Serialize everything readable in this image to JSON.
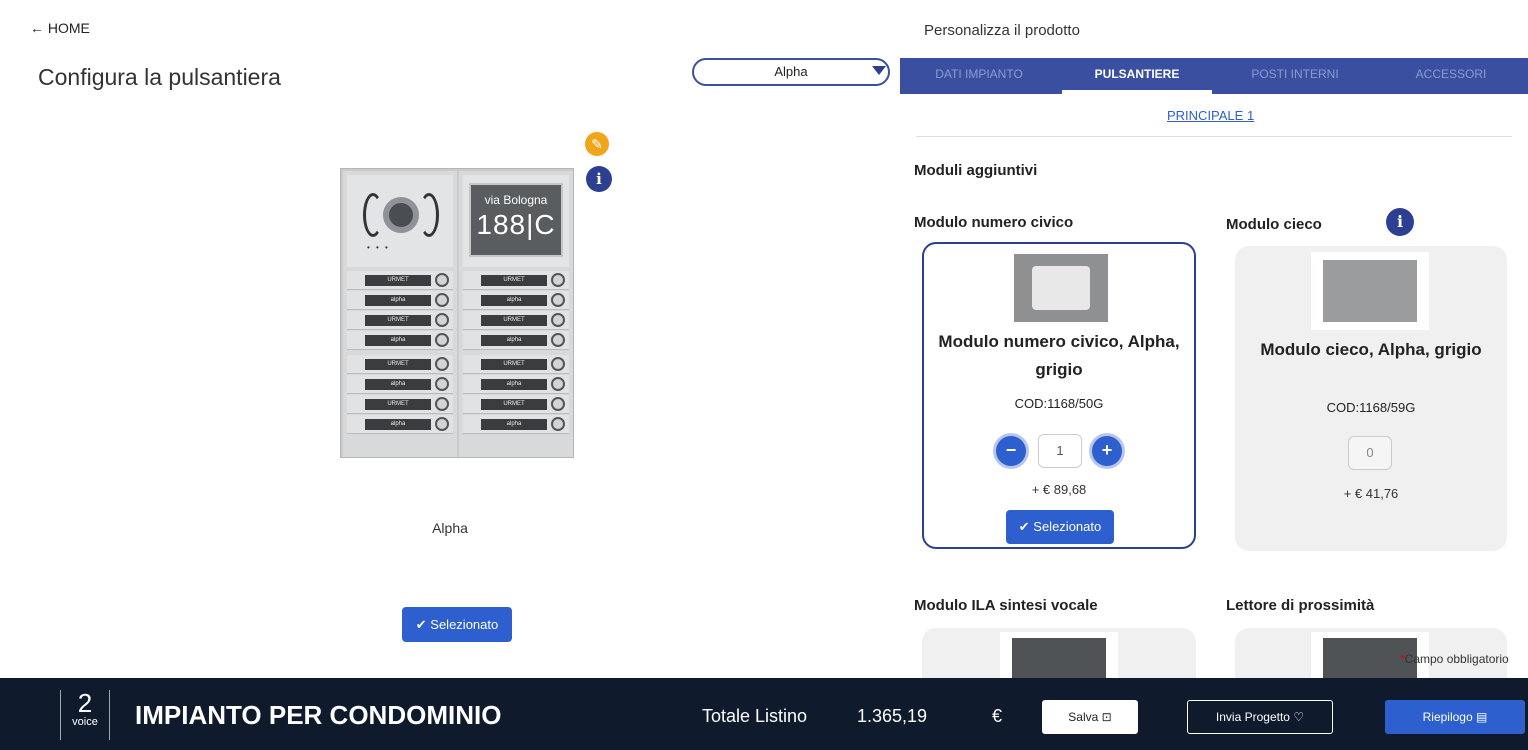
{
  "nav": {
    "home_label": "HOME"
  },
  "left": {
    "title": "Configura la pulsantiera",
    "model_select": "Alpha",
    "preview": {
      "display_line1": "via Bologna",
      "display_line2": "188|C",
      "button_tags": [
        "URMET",
        "alpha",
        "URMET",
        "alpha",
        "URMET",
        "alpha",
        "URMET",
        "alpha"
      ]
    },
    "model_name": "Alpha",
    "selected_label": "Selezionato"
  },
  "right": {
    "header": "Personalizza il prodotto",
    "tabs": [
      "DATI IMPIANTO",
      "PULSANTIERE",
      "POSTI INTERNI",
      "ACCESSORI"
    ],
    "active_tab": "PULSANTIERE",
    "sublink": "PRINCIPALE 1",
    "section_title": "Moduli aggiuntivi",
    "cards": [
      {
        "title": "Modulo numero civico",
        "name": "Modulo numero civico, Alpha, grigio",
        "code": "COD:1168/50G",
        "quantity": "1",
        "price": "+ € 89,68",
        "selected_label": "Selezionato"
      },
      {
        "title": "Modulo cieco",
        "name": "Modulo cieco, Alpha, grigio",
        "code": "COD:1168/59G",
        "quantity": "0",
        "price": "+ € 41,76"
      },
      {
        "title": "Modulo ILA sintesi vocale"
      },
      {
        "title": "Lettore di prossimità"
      }
    ],
    "required_note": "Campo obbligatorio"
  },
  "footer": {
    "logo_number": "2",
    "logo_text": "voice",
    "project_title": "IMPIANTO PER CONDOMINIO",
    "total_label": "Totale Listino",
    "total_value": "1.365,19",
    "currency": "€",
    "save_label": "Salva",
    "send_label": "Invia Progetto",
    "summary_label": "Riepilogo"
  },
  "colors": {
    "primary": "#3a4fa0",
    "accent": "#2d5fcf",
    "edit": "#f0a51a",
    "footer": "#0f1a2d"
  }
}
